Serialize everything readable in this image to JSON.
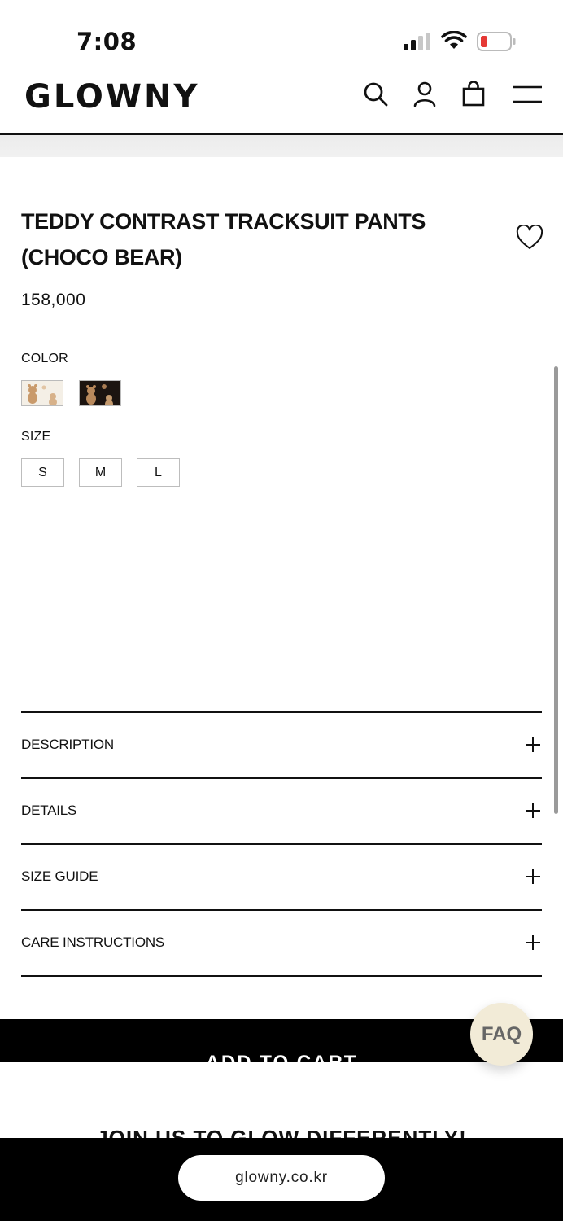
{
  "status_bar": {
    "time": "7:08",
    "signal_icon": "cellular-signal-icon",
    "wifi_icon": "wifi-icon",
    "battery_icon": "battery-low-icon",
    "battery_color": "#e53935"
  },
  "header": {
    "logo": "GLOWNY",
    "icons": [
      "search-icon",
      "account-icon",
      "shopping-bag-icon",
      "menu-icon"
    ]
  },
  "product": {
    "title_line1": "TEDDY CONTRAST TRACKSUIT PANTS",
    "title_line2": "(CHOCO BEAR)",
    "price": "158,000",
    "wishlist_icon": "heart-icon",
    "color_label": "COLOR",
    "color_swatches": [
      "cream-bear-swatch",
      "choco-bear-swatch"
    ],
    "size_label": "SIZE",
    "sizes": [
      "S",
      "M",
      "L"
    ]
  },
  "accordion": [
    {
      "label": "DESCRIPTION"
    },
    {
      "label": "DETAILS"
    },
    {
      "label": "SIZE GUIDE"
    },
    {
      "label": "CARE INSTRUCTIONS"
    }
  ],
  "cart": {
    "label": "ADD TO CART"
  },
  "faq": {
    "label": "FAQ",
    "color": "#f2ebd7"
  },
  "footer": {
    "join_text": "JOIN US TO GLOW DIFFERENTLY!"
  },
  "browser": {
    "url": "glowny.co.kr"
  }
}
